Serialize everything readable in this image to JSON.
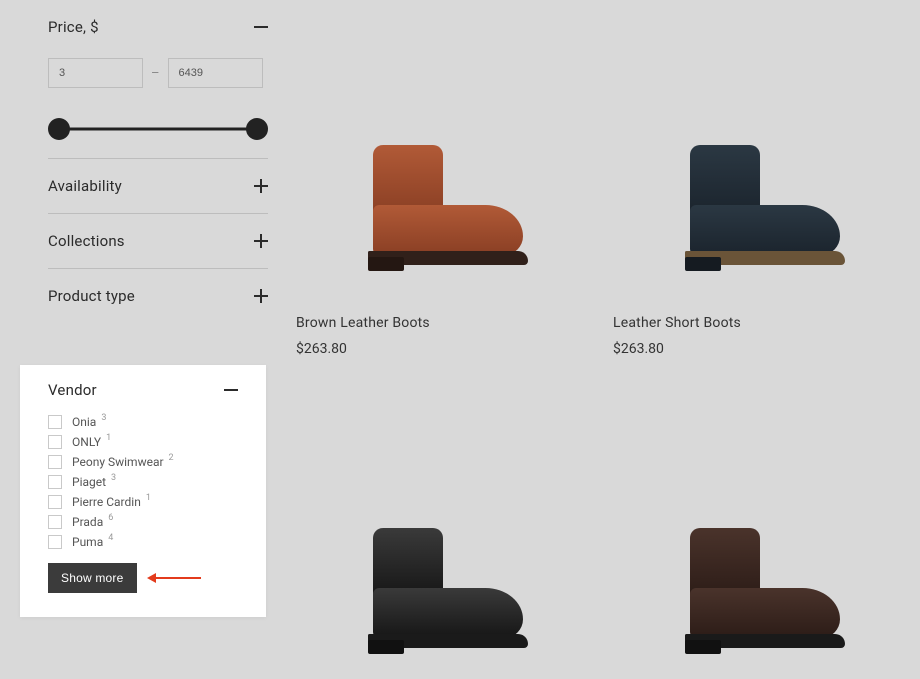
{
  "filters": {
    "price": {
      "label": "Price, $",
      "min": "3",
      "max": "6439"
    },
    "availability": {
      "label": "Availability"
    },
    "collections": {
      "label": "Collections"
    },
    "productType": {
      "label": "Product type"
    }
  },
  "vendor": {
    "label": "Vendor",
    "items": [
      {
        "label": "Onia",
        "count": "3"
      },
      {
        "label": "ONLY",
        "count": "1"
      },
      {
        "label": "Peony Swimwear",
        "count": "2"
      },
      {
        "label": "Piaget",
        "count": "3"
      },
      {
        "label": "Pierre Cardin",
        "count": "1"
      },
      {
        "label": "Prada",
        "count": "6"
      },
      {
        "label": "Puma",
        "count": "4"
      }
    ],
    "showMore": "Show more"
  },
  "products": [
    {
      "title": "Brown Leather Boots",
      "price": "$263.80"
    },
    {
      "title": "Leather Short Boots",
      "price": "$263.80"
    },
    {
      "title": "",
      "price": ""
    },
    {
      "title": "",
      "price": ""
    }
  ]
}
